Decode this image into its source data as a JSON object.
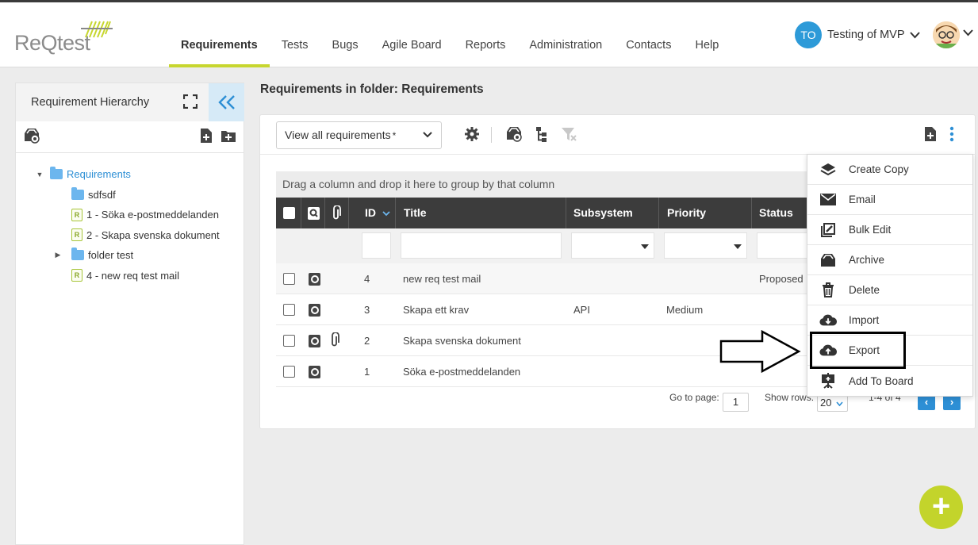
{
  "app": {
    "logo_text": "ReQtest",
    "nav": [
      "Requirements",
      "Tests",
      "Bugs",
      "Agile Board",
      "Reports",
      "Administration",
      "Contacts",
      "Help"
    ],
    "active_nav": "Requirements",
    "user_initials": "TO",
    "user_name": "Testing of MVP",
    "accent_color": "#c7d62f",
    "primary_color": "#2d8fd5"
  },
  "sidebar": {
    "title": "Requirement Hierarchy",
    "tree": [
      {
        "label": "Requirements",
        "kind": "folder",
        "level": 0,
        "expanded": true
      },
      {
        "label": "sdfsdf",
        "kind": "folder",
        "level": 1
      },
      {
        "label": "1 - Söka e-postmeddelanden",
        "kind": "requirement",
        "level": 1
      },
      {
        "label": "2 - Skapa svenska dokument",
        "kind": "requirement",
        "level": 1
      },
      {
        "label": "folder test",
        "kind": "folder",
        "level": 1,
        "expandable": true
      },
      {
        "label": "4 - new req test mail",
        "kind": "requirement",
        "level": 1
      }
    ]
  },
  "main": {
    "title": "Requirements in folder: Requirements",
    "view_select": "View all requirements",
    "view_select_marker": "*",
    "group_hint": "Drag a column and drop it here to group by that column",
    "columns": [
      "ID",
      "Title",
      "Subsystem",
      "Priority",
      "Status"
    ],
    "rows": [
      {
        "id": "4",
        "title": "new req test mail",
        "subsystem": "",
        "priority": "",
        "status": "Proposed",
        "attachment": false
      },
      {
        "id": "3",
        "title": "Skapa ett krav",
        "subsystem": "API",
        "priority": "Medium",
        "status": "",
        "attachment": false
      },
      {
        "id": "2",
        "title": "Skapa svenska dokument",
        "subsystem": "",
        "priority": "",
        "status": "",
        "attachment": true
      },
      {
        "id": "1",
        "title": "Söka e-postmeddelanden",
        "subsystem": "",
        "priority": "",
        "status": "",
        "attachment": false
      }
    ],
    "pager": {
      "go_to_page_label": "Go to page:",
      "page": "1",
      "show_rows_label": "Show rows:",
      "rows_per_page": "20",
      "range": "1-4 of 4",
      "prev": "‹",
      "next": "›"
    }
  },
  "menu": {
    "items": [
      {
        "label": "Create Copy",
        "icon": "layers-icon"
      },
      {
        "label": "Email",
        "icon": "envelope-icon"
      },
      {
        "label": "Bulk Edit",
        "icon": "bulk-edit-icon"
      },
      {
        "label": "Archive",
        "icon": "archive-icon"
      },
      {
        "label": "Delete",
        "icon": "trash-icon"
      },
      {
        "label": "Import",
        "icon": "cloud-download-icon"
      },
      {
        "label": "Export",
        "icon": "cloud-upload-icon"
      },
      {
        "label": "Add To Board",
        "icon": "board-icon"
      }
    ],
    "highlighted": "Export"
  },
  "fab": {
    "label": "+"
  }
}
